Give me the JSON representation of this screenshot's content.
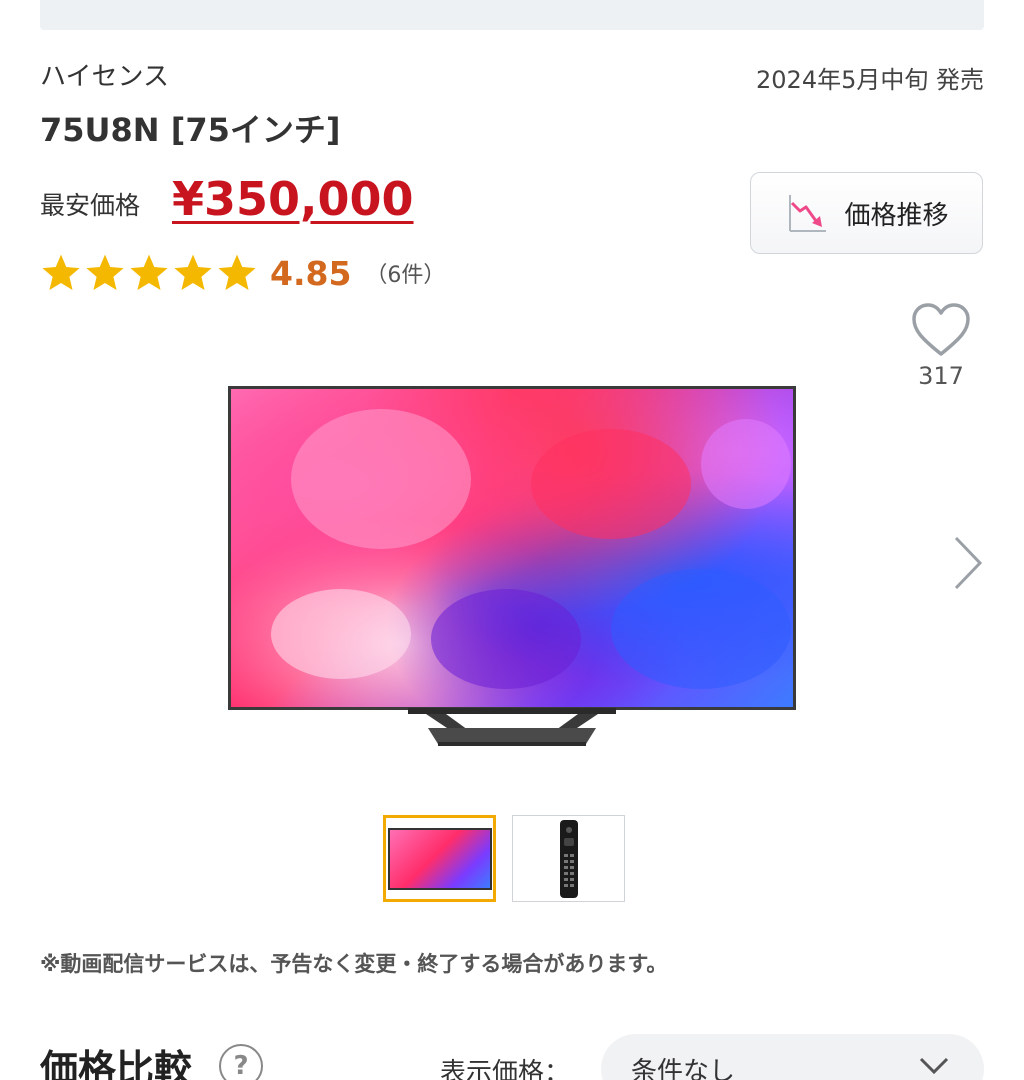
{
  "product": {
    "maker": "ハイセンス",
    "release": "2024年5月中旬 発売",
    "title": "75U8N [75インチ]"
  },
  "price": {
    "label": "最安価格",
    "value": "¥350,000",
    "trend_button": "価格推移",
    "trend_icon": "price-trend-chart-icon"
  },
  "rating": {
    "stars": 5,
    "score": "4.85",
    "count": "（6件）"
  },
  "favorite": {
    "icon": "heart-icon",
    "count": "317"
  },
  "gallery": {
    "main_image": "television",
    "thumbnails": [
      "television",
      "remote-control"
    ],
    "selected_index": 0
  },
  "notice": "※動画配信サービスは、予告なく変更・終了する場合があります。",
  "compare": {
    "title": "価格比較",
    "display_label": "表示価格：",
    "display_value": "条件なし"
  },
  "colors": {
    "price": "#c8141e",
    "score": "#d2691e",
    "star": "#f5b800",
    "thumb_selected": "#f2a900"
  }
}
